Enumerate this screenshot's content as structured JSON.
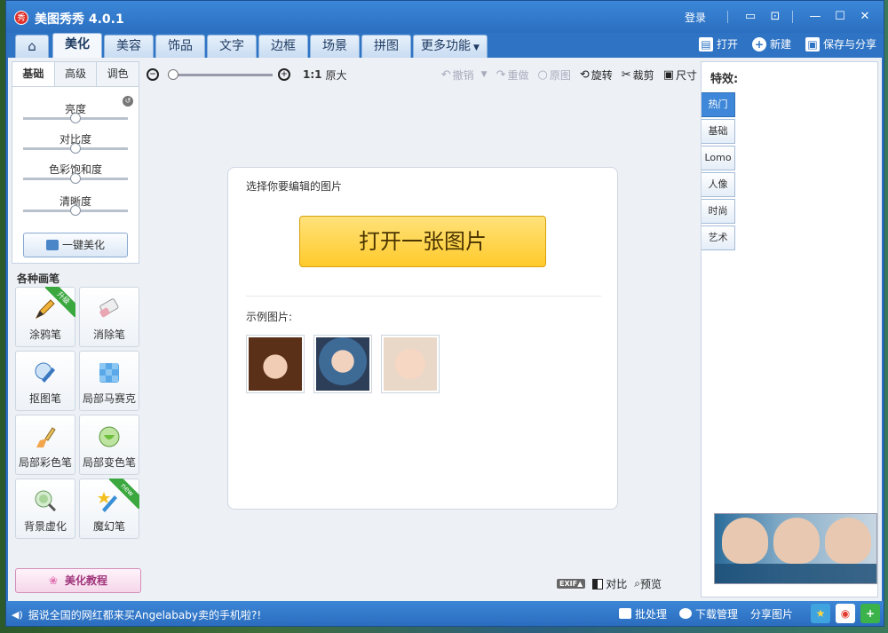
{
  "window": {
    "title": "美图秀秀 4.0.1",
    "logo_text": "秀",
    "login": "登录",
    "icons": [
      "chat-icon",
      "feedback-icon",
      "minimize-icon",
      "maximize-icon",
      "close-icon"
    ]
  },
  "tabs": [
    {
      "label": "⌂",
      "name": "home"
    },
    {
      "label": "美化",
      "name": "beautify",
      "active": true
    },
    {
      "label": "美容",
      "name": "cosmetic"
    },
    {
      "label": "饰品",
      "name": "accessories"
    },
    {
      "label": "文字",
      "name": "text"
    },
    {
      "label": "边框",
      "name": "frame"
    },
    {
      "label": "场景",
      "name": "scene"
    },
    {
      "label": "拼图",
      "name": "collage"
    },
    {
      "label": "更多功能",
      "name": "more"
    }
  ],
  "top_actions": {
    "open": "打开",
    "new": "新建",
    "save_share": "保存与分享"
  },
  "adjust_panel": {
    "tabs": [
      "基础",
      "高级",
      "调色"
    ],
    "sliders": [
      {
        "label": "亮度",
        "value": 0.5
      },
      {
        "label": "对比度",
        "value": 0.5
      },
      {
        "label": "色彩饱和度",
        "value": 0.5
      },
      {
        "label": "清晰度",
        "value": 0.5
      }
    ],
    "one_click": "一键美化"
  },
  "brushes": {
    "title": "各种画笔",
    "items": [
      {
        "label": "涂鸦笔",
        "badge": "升级"
      },
      {
        "label": "消除笔",
        "badge": ""
      },
      {
        "label": "抠图笔",
        "badge": ""
      },
      {
        "label": "局部马赛克",
        "badge": ""
      },
      {
        "label": "局部彩色笔",
        "badge": ""
      },
      {
        "label": "局部变色笔",
        "badge": ""
      },
      {
        "label": "背景虚化",
        "badge": ""
      },
      {
        "label": "魔幻笔",
        "badge": "new"
      }
    ]
  },
  "tutorial": "美化教程",
  "toolbar": {
    "ratio": "1:1",
    "original_size": "原大",
    "undo": "撤销",
    "redo": "重做",
    "original": "原图",
    "rotate": "旋转",
    "crop": "裁剪",
    "size": "尺寸"
  },
  "canvas": {
    "title": "选择你要编辑的图片",
    "open_button": "打开一张图片",
    "sample_title": "示例图片:"
  },
  "effects": {
    "title": "特效:",
    "categories": [
      "热门",
      "基础",
      "Lomo",
      "人像",
      "时尚",
      "艺术"
    ]
  },
  "bottom_tools": {
    "exif": "EXIF▲",
    "compare": "对比",
    "preview": "预览"
  },
  "status": {
    "message": "据说全国的网红都来买Angelababy卖的手机啦?!",
    "batch": "批处理",
    "download": "下载管理",
    "share": "分享图片"
  },
  "colors": {
    "accent": "#2f74c4",
    "open_button": "#ffca2b",
    "active_category": "#3f87d8"
  }
}
